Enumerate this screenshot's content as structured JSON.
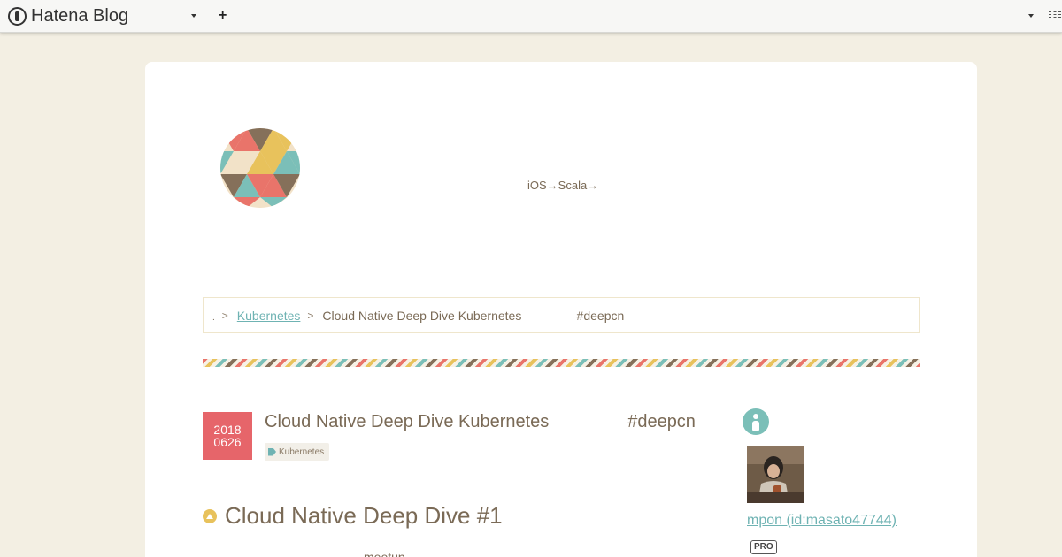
{
  "topbar": {
    "brand": "Hatena Blog",
    "add_label": "+"
  },
  "blog": {
    "tagline": "iOS→Scala→"
  },
  "breadcrumb": {
    "home": ".",
    "separator": ">",
    "category": "Kubernetes",
    "current": "Cloud Native Deep Dive Kubernetes                #deepcn"
  },
  "entry": {
    "date_year": "2018",
    "date_monthday": "0626",
    "title": "Cloud Native Deep Dive Kubernetes                #deepcn",
    "tag": "Kubernetes",
    "section_heading": "Cloud Native Deep Dive #1",
    "body_snippet": "meetup"
  },
  "sidebar": {
    "author_link": "mpon (id:masato47744)",
    "pro_badge": "PRO"
  },
  "colors": {
    "background": "#f3efe3",
    "accent_red": "#e6656a",
    "accent_teal": "#7bbfb8",
    "accent_yellow": "#e8c25c",
    "accent_brown": "#85705a",
    "text": "#7a6a56"
  },
  "icons": [
    "hatena-logo-icon",
    "dropdown-icon",
    "plus-icon",
    "loading-icon",
    "tag-icon",
    "heading-bullet-icon",
    "profile-icon"
  ]
}
